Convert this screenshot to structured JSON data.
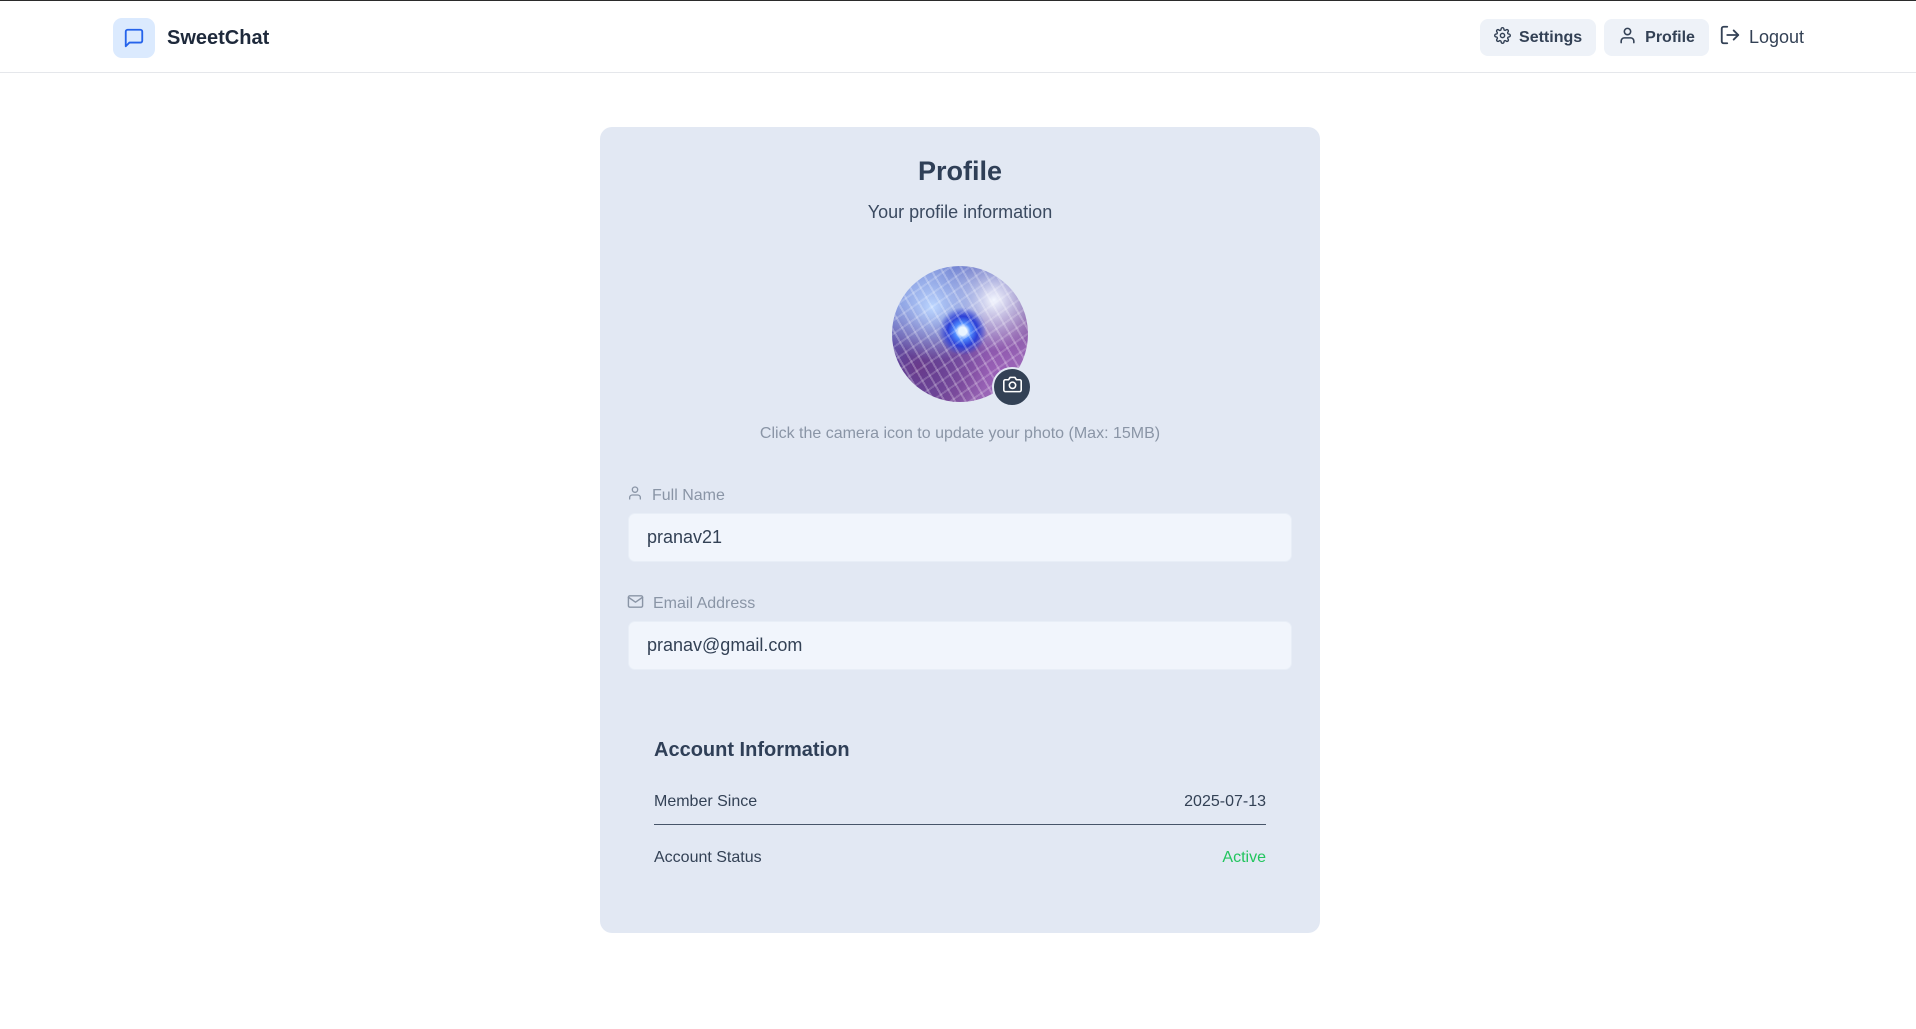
{
  "app": {
    "name": "SweetChat"
  },
  "nav": {
    "settings_label": "Settings",
    "profile_label": "Profile",
    "logout_label": "Logout"
  },
  "profile": {
    "title": "Profile",
    "subtitle": "Your profile information",
    "photo_hint": "Click the camera icon to update your photo (Max: 15MB)",
    "full_name_label": "Full Name",
    "full_name_value": "pranav21",
    "email_label": "Email Address",
    "email_value": "pranav@gmail.com"
  },
  "account": {
    "title": "Account Information",
    "member_since_label": "Member Since",
    "member_since_value": "2025-07-13",
    "status_label": "Account Status",
    "status_value": "Active"
  },
  "colors": {
    "accent": "#2563eb",
    "card_bg": "#e2e8f3",
    "status_active": "#22c55e"
  },
  "icons": {
    "brand": "message-square-icon",
    "settings": "gear-icon",
    "profile": "user-icon",
    "logout": "logout-icon",
    "camera": "camera-icon",
    "full_name": "user-icon",
    "email": "mail-icon"
  }
}
